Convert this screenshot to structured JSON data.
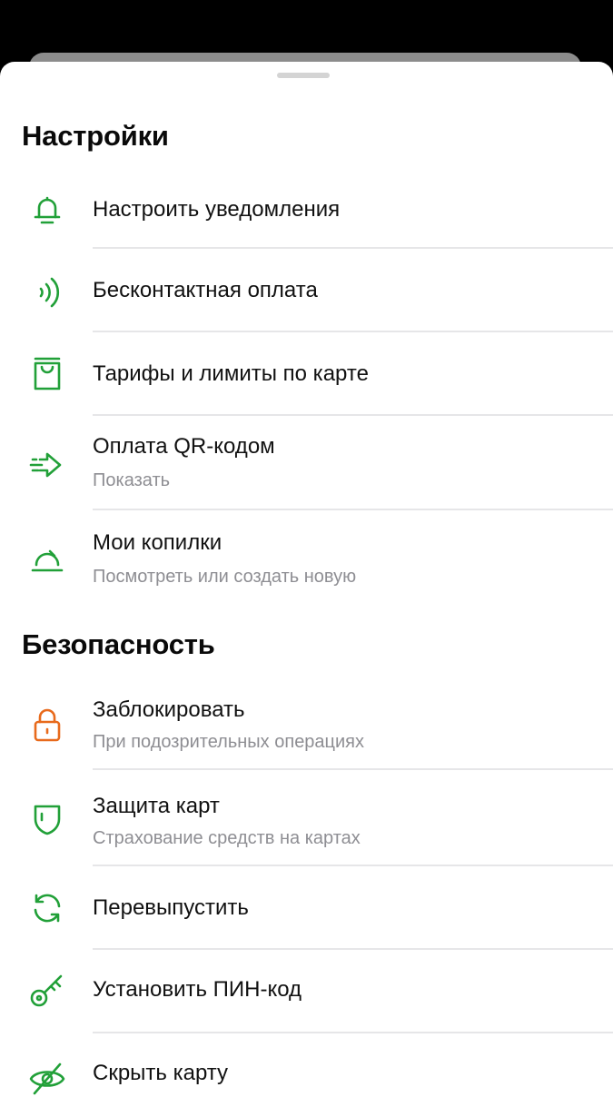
{
  "colors": {
    "accent_green": "#21a038",
    "accent_orange": "#e86a1c"
  },
  "settings": {
    "title": "Настройки",
    "items": [
      {
        "icon": "bell-icon",
        "title": "Настроить уведомления"
      },
      {
        "icon": "contactless-icon",
        "title": "Бесконтактная оплата"
      },
      {
        "icon": "shopping-bag-icon",
        "title": "Тарифы и лимиты по карте"
      },
      {
        "icon": "arrow-right-icon",
        "title": "Оплата QR-кодом",
        "subtitle": "Показать"
      },
      {
        "icon": "piggy-bank-icon",
        "title": "Мои копилки",
        "subtitle": "Посмотреть или создать новую"
      }
    ]
  },
  "security": {
    "title": "Безопасность",
    "items": [
      {
        "icon": "lock-icon",
        "title": "Заблокировать",
        "subtitle": "При подозрительных операциях"
      },
      {
        "icon": "shield-icon",
        "title": "Защита карт",
        "subtitle": "Страхование средств на картах"
      },
      {
        "icon": "refresh-icon",
        "title": "Перевыпустить"
      },
      {
        "icon": "key-icon",
        "title": "Установить ПИН-код"
      },
      {
        "icon": "eye-off-icon",
        "title": "Скрыть карту"
      }
    ]
  }
}
